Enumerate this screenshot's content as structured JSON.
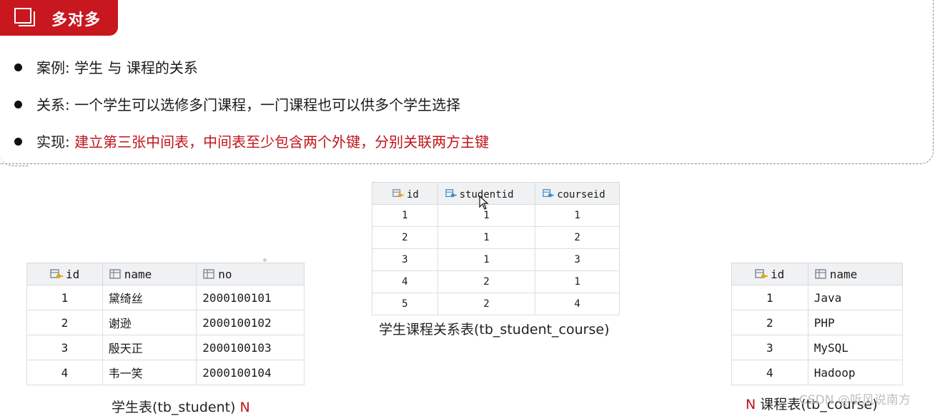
{
  "header": {
    "title": "多对多"
  },
  "bullets": [
    {
      "label": "案例: ",
      "text": "学生 与 课程的关系",
      "highlight": false
    },
    {
      "label": "关系: ",
      "text": "一个学生可以选修多门课程，一门课程也可以供多个学生选择",
      "highlight": false
    },
    {
      "label": "实现: ",
      "text": "建立第三张中间表，中间表至少包含两个外键，分别关联两方主键",
      "highlight": true
    }
  ],
  "student_table": {
    "headers": [
      "id",
      "name",
      "no"
    ],
    "rows": [
      [
        "1",
        "黛绮丝",
        "2000100101"
      ],
      [
        "2",
        "谢逊",
        "2000100102"
      ],
      [
        "3",
        "殷天正",
        "2000100103"
      ],
      [
        "4",
        "韦一笑",
        "2000100104"
      ]
    ],
    "caption": "学生表(tb_student)",
    "caption_mark": "N"
  },
  "relation_table": {
    "headers": [
      "id",
      "studentid",
      "courseid"
    ],
    "rows": [
      [
        "1",
        "1",
        "1"
      ],
      [
        "2",
        "1",
        "2"
      ],
      [
        "3",
        "1",
        "3"
      ],
      [
        "4",
        "2",
        "1"
      ],
      [
        "5",
        "2",
        "4"
      ]
    ],
    "caption": "学生课程关系表(tb_student_course)"
  },
  "course_table": {
    "headers": [
      "id",
      "name"
    ],
    "rows": [
      [
        "1",
        "Java"
      ],
      [
        "2",
        "PHP"
      ],
      [
        "3",
        "MySQL"
      ],
      [
        "4",
        "Hadoop"
      ]
    ],
    "caption_mark": "N",
    "caption": "课程表(tb_course)"
  },
  "watermark": "CSDN @听风说南方",
  "colors": {
    "accent_red": "#c8171e",
    "highlight_text": "#c0141a",
    "table_header_bg": "#f0f1f3"
  }
}
